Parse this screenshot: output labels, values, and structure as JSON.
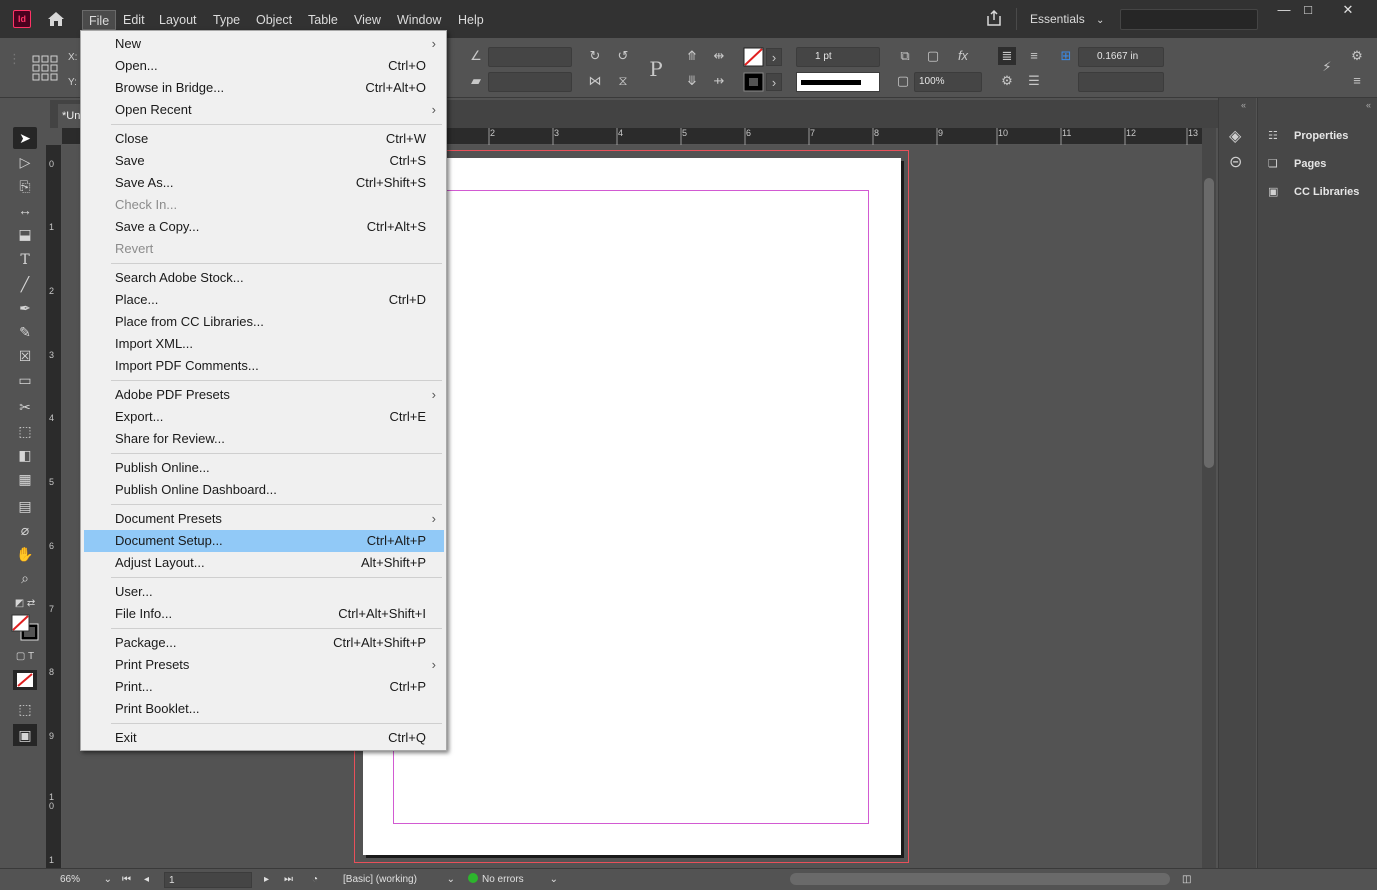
{
  "menubar": {
    "logo": "Id",
    "items": [
      "File",
      "Edit",
      "Layout",
      "Type",
      "Object",
      "Table",
      "View",
      "Window",
      "Help"
    ],
    "workspace": "Essentials",
    "win_min": "—",
    "win_max": "□",
    "win_close": "✕"
  },
  "control": {
    "x_label": "X:",
    "y_label": "Y:",
    "stroke_weight": "1 pt",
    "opacity": "100%",
    "offset": "0.1667 in"
  },
  "tab": {
    "title": "*Un"
  },
  "ruler": {
    "h_labels": [
      "2",
      "3",
      "4",
      "5",
      "6",
      "7",
      "8",
      "9",
      "10",
      "11",
      "12",
      "13"
    ],
    "v_labels": [
      "0",
      "1",
      "2",
      "3",
      "4",
      "5",
      "6",
      "7",
      "8",
      "9",
      "1\n0",
      "1"
    ]
  },
  "panels": {
    "items": [
      {
        "label": "Properties",
        "icon": "properties-icon"
      },
      {
        "label": "Pages",
        "icon": "pages-icon"
      },
      {
        "label": "CC Libraries",
        "icon": "cc-libraries-icon"
      }
    ]
  },
  "status": {
    "zoom": "66%",
    "page": "1",
    "preflight_profile": "[Basic] (working)",
    "errors": "No errors",
    "status_color": "#2db52d"
  },
  "file_menu": {
    "items": [
      {
        "label": "New",
        "shortcut": "",
        "submenu": true,
        "disabled": false
      },
      {
        "label": "Open...",
        "shortcut": "Ctrl+O",
        "submenu": false,
        "disabled": false
      },
      {
        "label": "Browse in Bridge...",
        "shortcut": "Ctrl+Alt+O",
        "submenu": false,
        "disabled": false
      },
      {
        "label": "Open Recent",
        "shortcut": "",
        "submenu": true,
        "disabled": false
      },
      {
        "sep": true
      },
      {
        "label": "Close",
        "shortcut": "Ctrl+W",
        "submenu": false,
        "disabled": false
      },
      {
        "label": "Save",
        "shortcut": "Ctrl+S",
        "submenu": false,
        "disabled": false
      },
      {
        "label": "Save As...",
        "shortcut": "Ctrl+Shift+S",
        "submenu": false,
        "disabled": false
      },
      {
        "label": "Check In...",
        "shortcut": "",
        "submenu": false,
        "disabled": true
      },
      {
        "label": "Save a Copy...",
        "shortcut": "Ctrl+Alt+S",
        "submenu": false,
        "disabled": false
      },
      {
        "label": "Revert",
        "shortcut": "",
        "submenu": false,
        "disabled": true
      },
      {
        "sep": true
      },
      {
        "label": "Search Adobe Stock...",
        "shortcut": "",
        "submenu": false,
        "disabled": false
      },
      {
        "label": "Place...",
        "shortcut": "Ctrl+D",
        "submenu": false,
        "disabled": false
      },
      {
        "label": "Place from CC Libraries...",
        "shortcut": "",
        "submenu": false,
        "disabled": false
      },
      {
        "label": "Import XML...",
        "shortcut": "",
        "submenu": false,
        "disabled": false
      },
      {
        "label": "Import PDF Comments...",
        "shortcut": "",
        "submenu": false,
        "disabled": false
      },
      {
        "sep": true
      },
      {
        "label": "Adobe PDF Presets",
        "shortcut": "",
        "submenu": true,
        "disabled": false
      },
      {
        "label": "Export...",
        "shortcut": "Ctrl+E",
        "submenu": false,
        "disabled": false
      },
      {
        "label": "Share for Review...",
        "shortcut": "",
        "submenu": false,
        "disabled": false
      },
      {
        "sep": true
      },
      {
        "label": "Publish Online...",
        "shortcut": "",
        "submenu": false,
        "disabled": false
      },
      {
        "label": "Publish Online Dashboard...",
        "shortcut": "",
        "submenu": false,
        "disabled": false
      },
      {
        "sep": true
      },
      {
        "label": "Document Presets",
        "shortcut": "",
        "submenu": true,
        "disabled": false
      },
      {
        "label": "Document Setup...",
        "shortcut": "Ctrl+Alt+P",
        "submenu": false,
        "disabled": false,
        "highlighted": true
      },
      {
        "label": "Adjust Layout...",
        "shortcut": "Alt+Shift+P",
        "submenu": false,
        "disabled": false
      },
      {
        "sep": true
      },
      {
        "label": "User...",
        "shortcut": "",
        "submenu": false,
        "disabled": false
      },
      {
        "label": "File Info...",
        "shortcut": "Ctrl+Alt+Shift+I",
        "submenu": false,
        "disabled": false
      },
      {
        "sep": true
      },
      {
        "label": "Package...",
        "shortcut": "Ctrl+Alt+Shift+P",
        "submenu": false,
        "disabled": false
      },
      {
        "label": "Print Presets",
        "shortcut": "",
        "submenu": true,
        "disabled": false
      },
      {
        "label": "Print...",
        "shortcut": "Ctrl+P",
        "submenu": false,
        "disabled": false
      },
      {
        "label": "Print Booklet...",
        "shortcut": "",
        "submenu": false,
        "disabled": false
      },
      {
        "sep": true
      },
      {
        "label": "Exit",
        "shortcut": "Ctrl+Q",
        "submenu": false,
        "disabled": false
      }
    ]
  }
}
